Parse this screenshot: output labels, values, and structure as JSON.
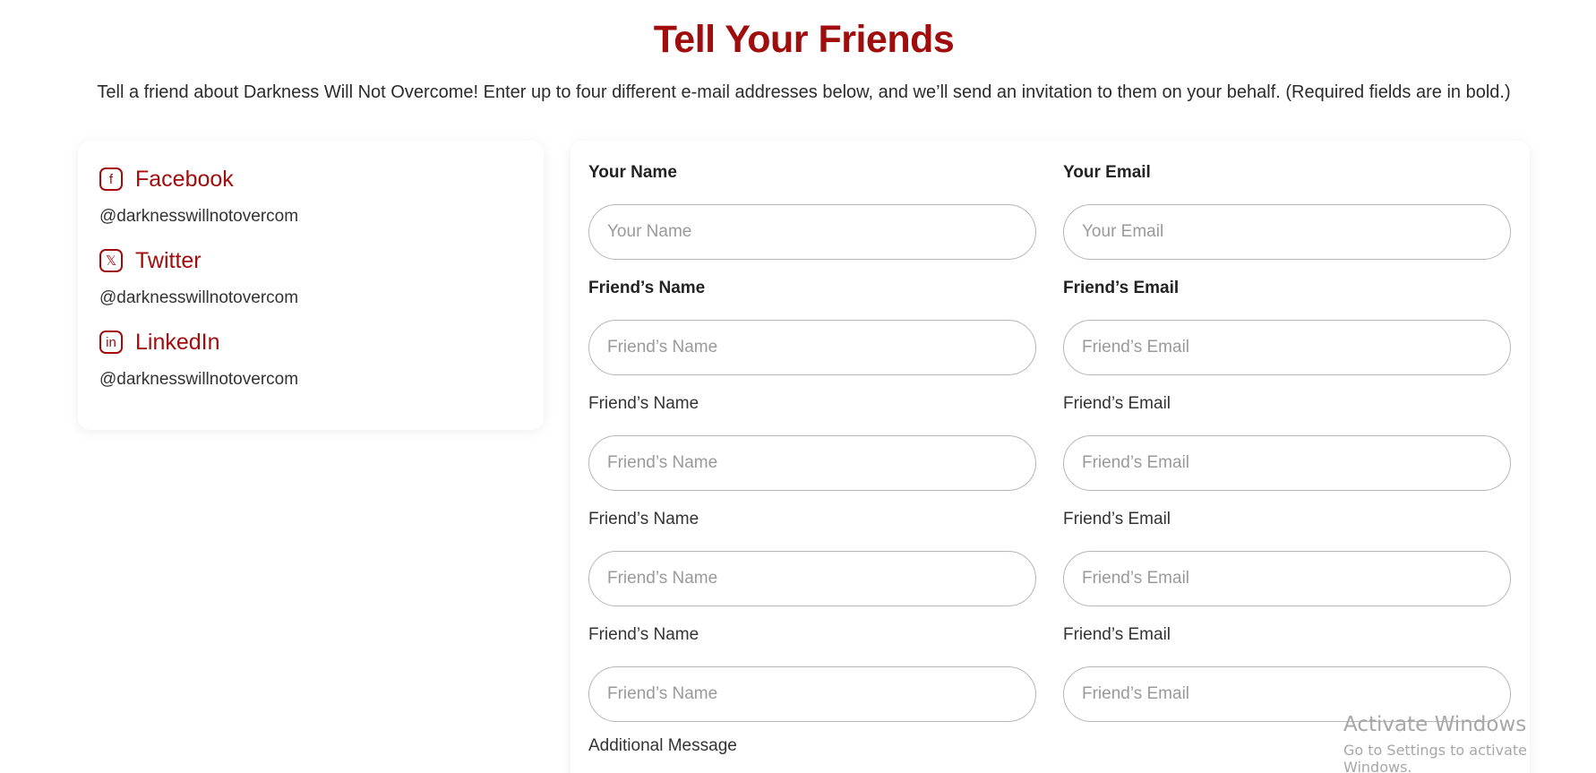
{
  "header": {
    "title": "Tell Your Friends",
    "intro": "Tell a friend about Darkness Will Not Overcome! Enter up to four different e-mail addresses below, and we’ll send an invitation to them on your behalf. (Required fields are in bold.)"
  },
  "social": {
    "items": [
      {
        "icon": "facebook-icon",
        "glyph": "f",
        "name": "Facebook",
        "handle": "@darknesswillnotovercom"
      },
      {
        "icon": "twitter-x-icon",
        "glyph": "𝕏",
        "name": "Twitter",
        "handle": "@darknesswillnotovercom"
      },
      {
        "icon": "linkedin-icon",
        "glyph": "in",
        "name": "LinkedIn",
        "handle": "@darknesswillnotovercom"
      }
    ]
  },
  "form": {
    "your_name": {
      "label": "Your Name",
      "placeholder": "Your Name",
      "value": ""
    },
    "your_email": {
      "label": "Your Email",
      "placeholder": "Your Email",
      "value": ""
    },
    "friends": [
      {
        "name_label": "Friend’s Name",
        "name_placeholder": "Friend’s Name",
        "email_label": "Friend’s Email",
        "email_placeholder": "Friend’s Email"
      },
      {
        "name_label": "Friend’s Name",
        "name_placeholder": "Friend’s Name",
        "email_label": "Friend’s Email",
        "email_placeholder": "Friend’s Email"
      },
      {
        "name_label": "Friend’s Name",
        "name_placeholder": "Friend’s Name",
        "email_label": "Friend’s Email",
        "email_placeholder": "Friend’s Email"
      },
      {
        "name_label": "Friend’s Name",
        "name_placeholder": "Friend’s Name",
        "email_label": "Friend’s Email",
        "email_placeholder": "Friend’s Email"
      }
    ],
    "message_label": "Additional Message"
  },
  "watermark": {
    "line1": "Activate Windows",
    "line2": "Go to Settings to activate Windows."
  },
  "colors": {
    "accent": "#a00d0d",
    "text": "#333333",
    "input_border": "#b5b5b5",
    "placeholder": "#9a9a9a"
  }
}
